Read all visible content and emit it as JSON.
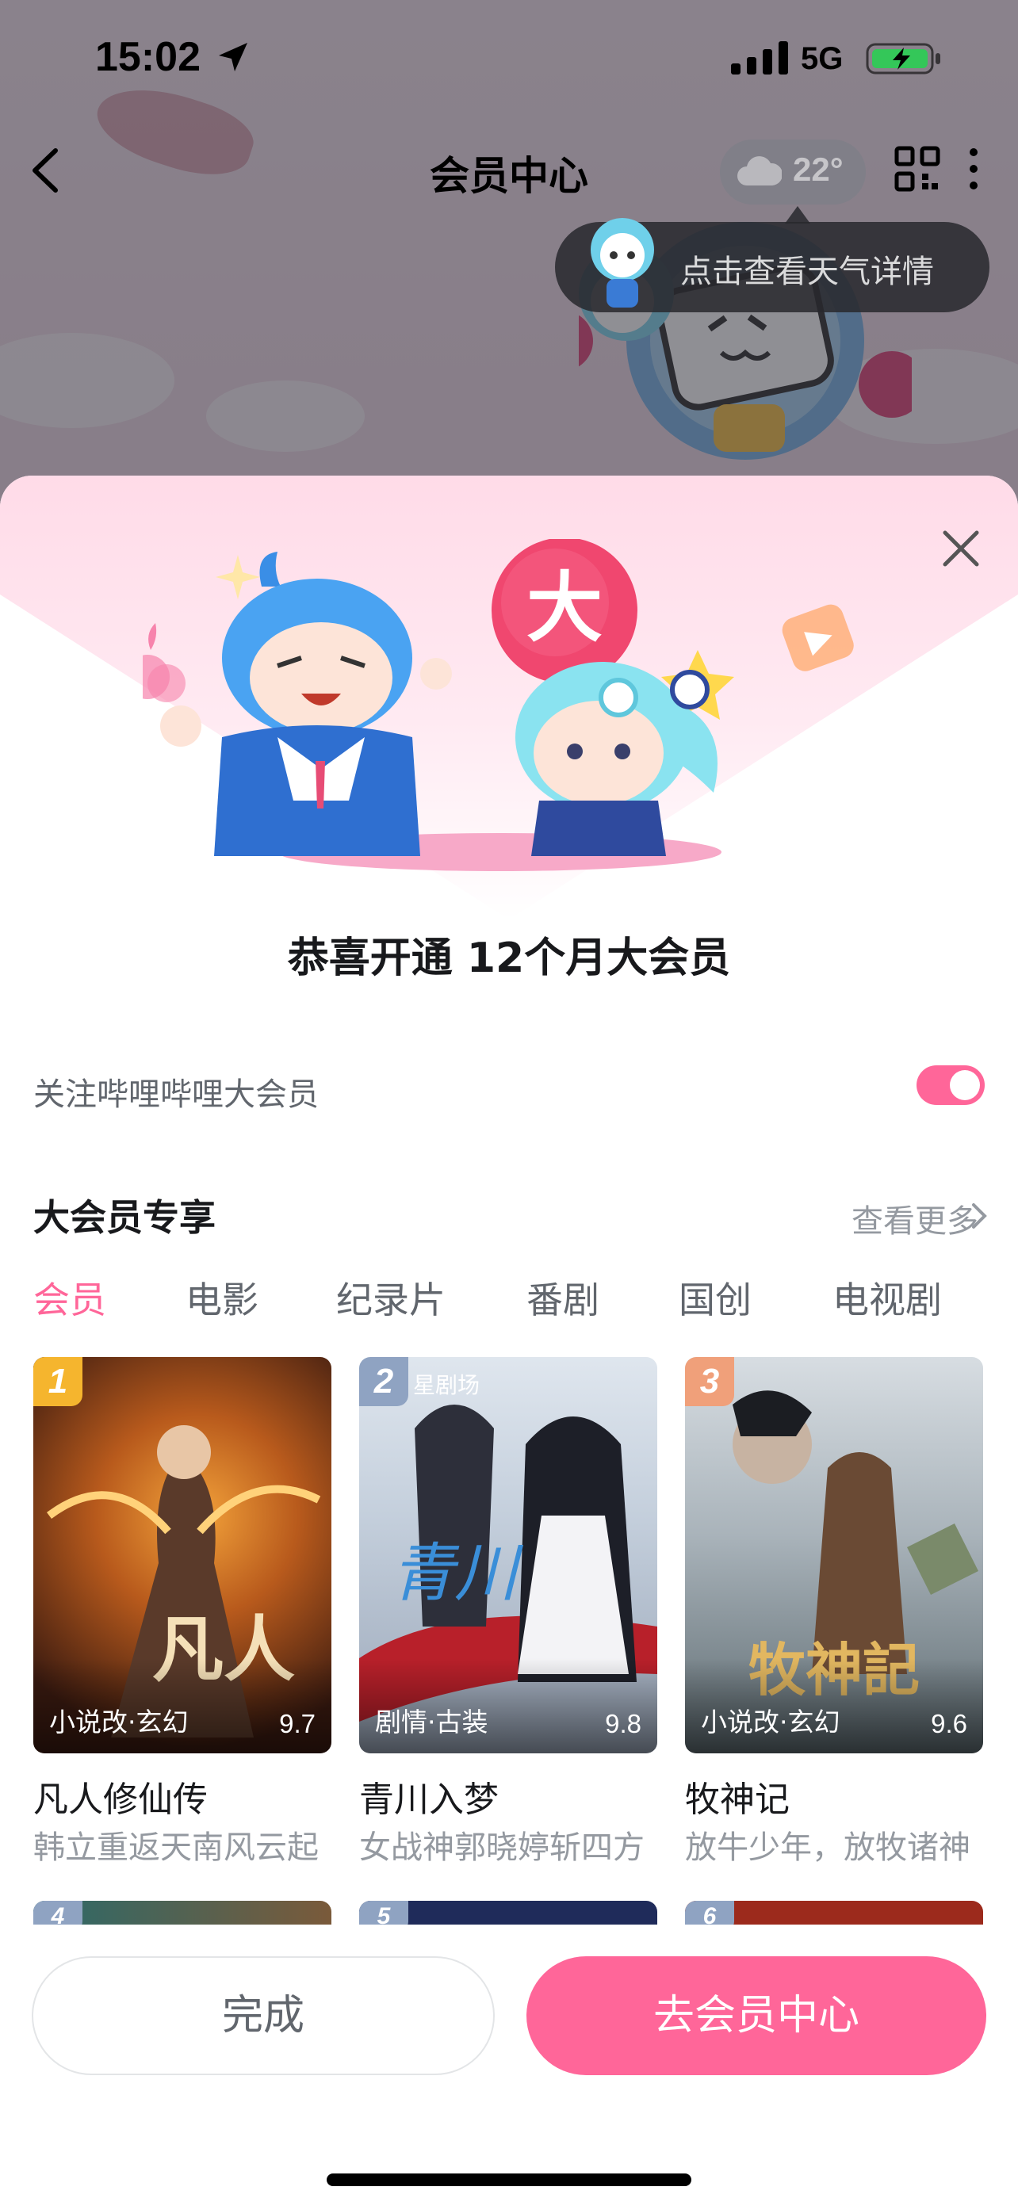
{
  "status_bar": {
    "time": "15:02",
    "network": "5G"
  },
  "nav": {
    "title": "会员中心",
    "weather_temp": "22°"
  },
  "tooltip": {
    "text": "点击查看天气详情"
  },
  "sheet": {
    "congrats": "恭喜开通 12个月大会员",
    "follow_label": "关注哔哩哔哩大会员",
    "follow_enabled": true,
    "section_title": "大会员专享",
    "see_more": "查看更多",
    "tabs": [
      "会员",
      "电影",
      "纪录片",
      "番剧",
      "国创",
      "电视剧"
    ],
    "active_tab": "会员",
    "illustration_badge": "大",
    "cards": [
      {
        "rank": "1",
        "tag": "小说改·玄幻",
        "score": "9.7",
        "title": "凡人修仙传",
        "subtitle": "韩立重返天南风云起",
        "rank_color": "#f5b52e"
      },
      {
        "rank": "2",
        "tag": "剧情·古装",
        "score": "9.8",
        "title": "青川入梦",
        "subtitle": "女战神郭晓婷斩四方",
        "rank_color": "#8fa3c2",
        "brand": "星剧场"
      },
      {
        "rank": "3",
        "tag": "小说改·玄幻",
        "score": "9.6",
        "title": "牧神记",
        "subtitle": "放牛少年，放牧诸神",
        "rank_color": "#f0a07a"
      }
    ],
    "next_ranks": [
      "4",
      "5",
      "6"
    ]
  },
  "buttons": {
    "done": "完成",
    "go_member_center": "去会员中心"
  },
  "colors": {
    "accent": "#ff6699"
  }
}
